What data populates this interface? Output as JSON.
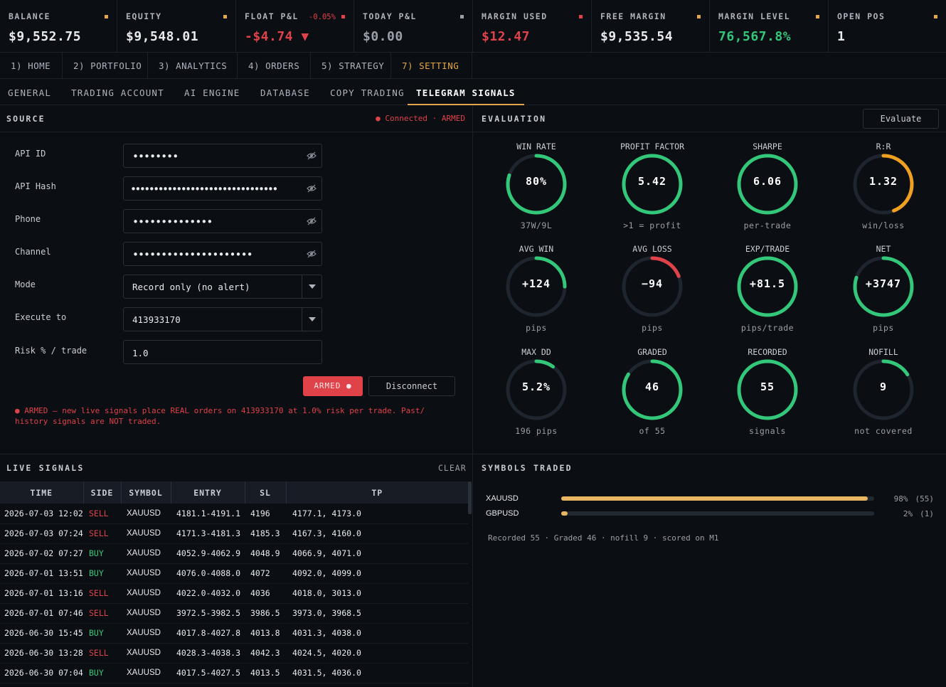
{
  "stats": [
    {
      "label": "BALANCE",
      "value": "$9,552.75",
      "value_color": "#e8eaee",
      "marker_color": "#e3a64a"
    },
    {
      "label": "EQUITY",
      "value": "$9,548.01",
      "value_color": "#e8eaee",
      "marker_color": "#e3a64a"
    },
    {
      "label": "FLOAT P&L",
      "pct": "-0.05%",
      "value": "-$4.74 ▼",
      "value_color": "#e0424a",
      "marker_color": "#e0424a"
    },
    {
      "label": "TODAY P&L",
      "value": "$0.00",
      "value_color": "#9aa0a8",
      "marker_color": "#9aa0a8"
    },
    {
      "label": "MARGIN USED",
      "value": "$12.47",
      "value_color": "#e0424a",
      "marker_color": "#e0424a"
    },
    {
      "label": "FREE MARGIN",
      "value": "$9,535.54",
      "value_color": "#e8eaee",
      "marker_color": "#e3a64a"
    },
    {
      "label": "MARGIN LEVEL",
      "value": "76,567.8%",
      "value_color": "#33c77a",
      "marker_color": "#e3a64a"
    },
    {
      "label": "OPEN POS",
      "value": "1",
      "value_color": "#e8eaee",
      "marker_color": "#e3a64a"
    }
  ],
  "nav": [
    "1) HOME",
    "2) PORTFOLIO",
    "3) ANALYTICS",
    "4) ORDERS",
    "5) STRATEGY",
    "7) SETTING"
  ],
  "subtabs": [
    "GENERAL",
    "TRADING ACCOUNT",
    "AI ENGINE",
    "DATABASE",
    "COPY TRADING",
    "TELEGRAM SIGNALS"
  ],
  "source": {
    "title": "SOURCE",
    "status": "● Connected · ARMED",
    "fields": {
      "api_id": {
        "label": "API ID",
        "value": "••••••••"
      },
      "api_hash": {
        "label": "API Hash",
        "value": "••••••••••••••••••••••••••••••••"
      },
      "phone": {
        "label": "Phone",
        "value": "••••••••••••••"
      },
      "channel": {
        "label": "Channel",
        "value": "•••••••••••••••••••••"
      },
      "mode": {
        "label": "Mode",
        "value": "Record only (no alert)"
      },
      "execute_to": {
        "label": "Execute to",
        "value": "413933170"
      },
      "risk": {
        "label": "Risk % / trade",
        "value": "1.0"
      }
    },
    "armed_button": "ARMED ●",
    "disconnect_button": "Disconnect",
    "warning": "● ARMED — new live signals place REAL orders on 413933170 at 1.0% risk per trade. Past/ history signals are NOT traded."
  },
  "evaluation": {
    "title": "EVALUATION",
    "evaluate_button": "Evaluate",
    "gauges": [
      {
        "label": "WIN RATE",
        "value": "80%",
        "sub": "37W/9L",
        "fraction": 0.8,
        "color": "#33c77a"
      },
      {
        "label": "PROFIT FACTOR",
        "value": "5.42",
        "sub": ">1 = profit",
        "fraction": 1.0,
        "color": "#33c77a"
      },
      {
        "label": "SHARPE",
        "value": "6.06",
        "sub": "per-trade",
        "fraction": 1.0,
        "color": "#33c77a"
      },
      {
        "label": "R:R",
        "value": "1.32",
        "sub": "win/loss",
        "fraction": 0.44,
        "color": "#f0a020"
      },
      {
        "label": "AVG WIN",
        "value": "+124",
        "sub": "pips",
        "fraction": 0.25,
        "color": "#33c77a"
      },
      {
        "label": "AVG LOSS",
        "value": "−94",
        "sub": "pips",
        "fraction": 0.19,
        "color": "#e0424a"
      },
      {
        "label": "EXP/TRADE",
        "value": "+81.5",
        "sub": "pips/trade",
        "fraction": 1.0,
        "color": "#33c77a"
      },
      {
        "label": "NET",
        "value": "+3747",
        "sub": "pips",
        "fraction": 0.8,
        "color": "#33c77a"
      },
      {
        "label": "MAX DD",
        "value": "5.2%",
        "sub": "196 pips",
        "fraction": 0.1,
        "color": "#33c77a"
      },
      {
        "label": "GRADED",
        "value": "46",
        "sub": "of 55",
        "fraction": 0.84,
        "color": "#33c77a"
      },
      {
        "label": "RECORDED",
        "value": "55",
        "sub": "signals",
        "fraction": 1.0,
        "color": "#33c77a"
      },
      {
        "label": "NOFILL",
        "value": "9",
        "sub": "not covered",
        "fraction": 0.16,
        "color": "#33c77a"
      }
    ]
  },
  "signals": {
    "title": "LIVE SIGNALS",
    "clear_label": "CLEAR",
    "columns": [
      "TIME",
      "SIDE",
      "SYMBOL",
      "ENTRY",
      "SL",
      "TP"
    ],
    "rows": [
      [
        "2026-07-03 12:02",
        "SELL",
        "XAUUSD",
        "4181.1-4191.1",
        "4196",
        "4177.1, 4173.0"
      ],
      [
        "2026-07-03 07:24",
        "SELL",
        "XAUUSD",
        "4171.3-4181.3",
        "4185.3",
        "4167.3, 4160.0"
      ],
      [
        "2026-07-02 07:27",
        "BUY",
        "XAUUSD",
        "4052.9-4062.9",
        "4048.9",
        "4066.9, 4071.0"
      ],
      [
        "2026-07-01 13:51",
        "BUY",
        "XAUUSD",
        "4076.0-4088.0",
        "4072",
        "4092.0, 4099.0"
      ],
      [
        "2026-07-01 13:16",
        "SELL",
        "XAUUSD",
        "4022.0-4032.0",
        "4036",
        "4018.0, 3013.0"
      ],
      [
        "2026-07-01 07:46",
        "SELL",
        "XAUUSD",
        "3972.5-3982.5",
        "3986.5",
        "3973.0, 3968.5"
      ],
      [
        "2026-06-30 15:45",
        "BUY",
        "XAUUSD",
        "4017.8-4027.8",
        "4013.8",
        "4031.3, 4038.0"
      ],
      [
        "2026-06-30 13:28",
        "SELL",
        "XAUUSD",
        "4028.3-4038.3",
        "4042.3",
        "4024.5, 4020.0"
      ],
      [
        "2026-06-30 07:04",
        "BUY",
        "XAUUSD",
        "4017.5-4027.5",
        "4013.5",
        "4031.5, 4036.0"
      ]
    ]
  },
  "symbols": {
    "title": "SYMBOLS TRADED",
    "items": [
      {
        "symbol": "XAUUSD",
        "fraction": 0.98,
        "pct": "98%",
        "count": "(55)"
      },
      {
        "symbol": "GBPUSD",
        "fraction": 0.02,
        "pct": "2%",
        "count": "(1)"
      }
    ],
    "note": "Recorded 55 · Graded 46 · nofill 9 · scored on M1"
  }
}
